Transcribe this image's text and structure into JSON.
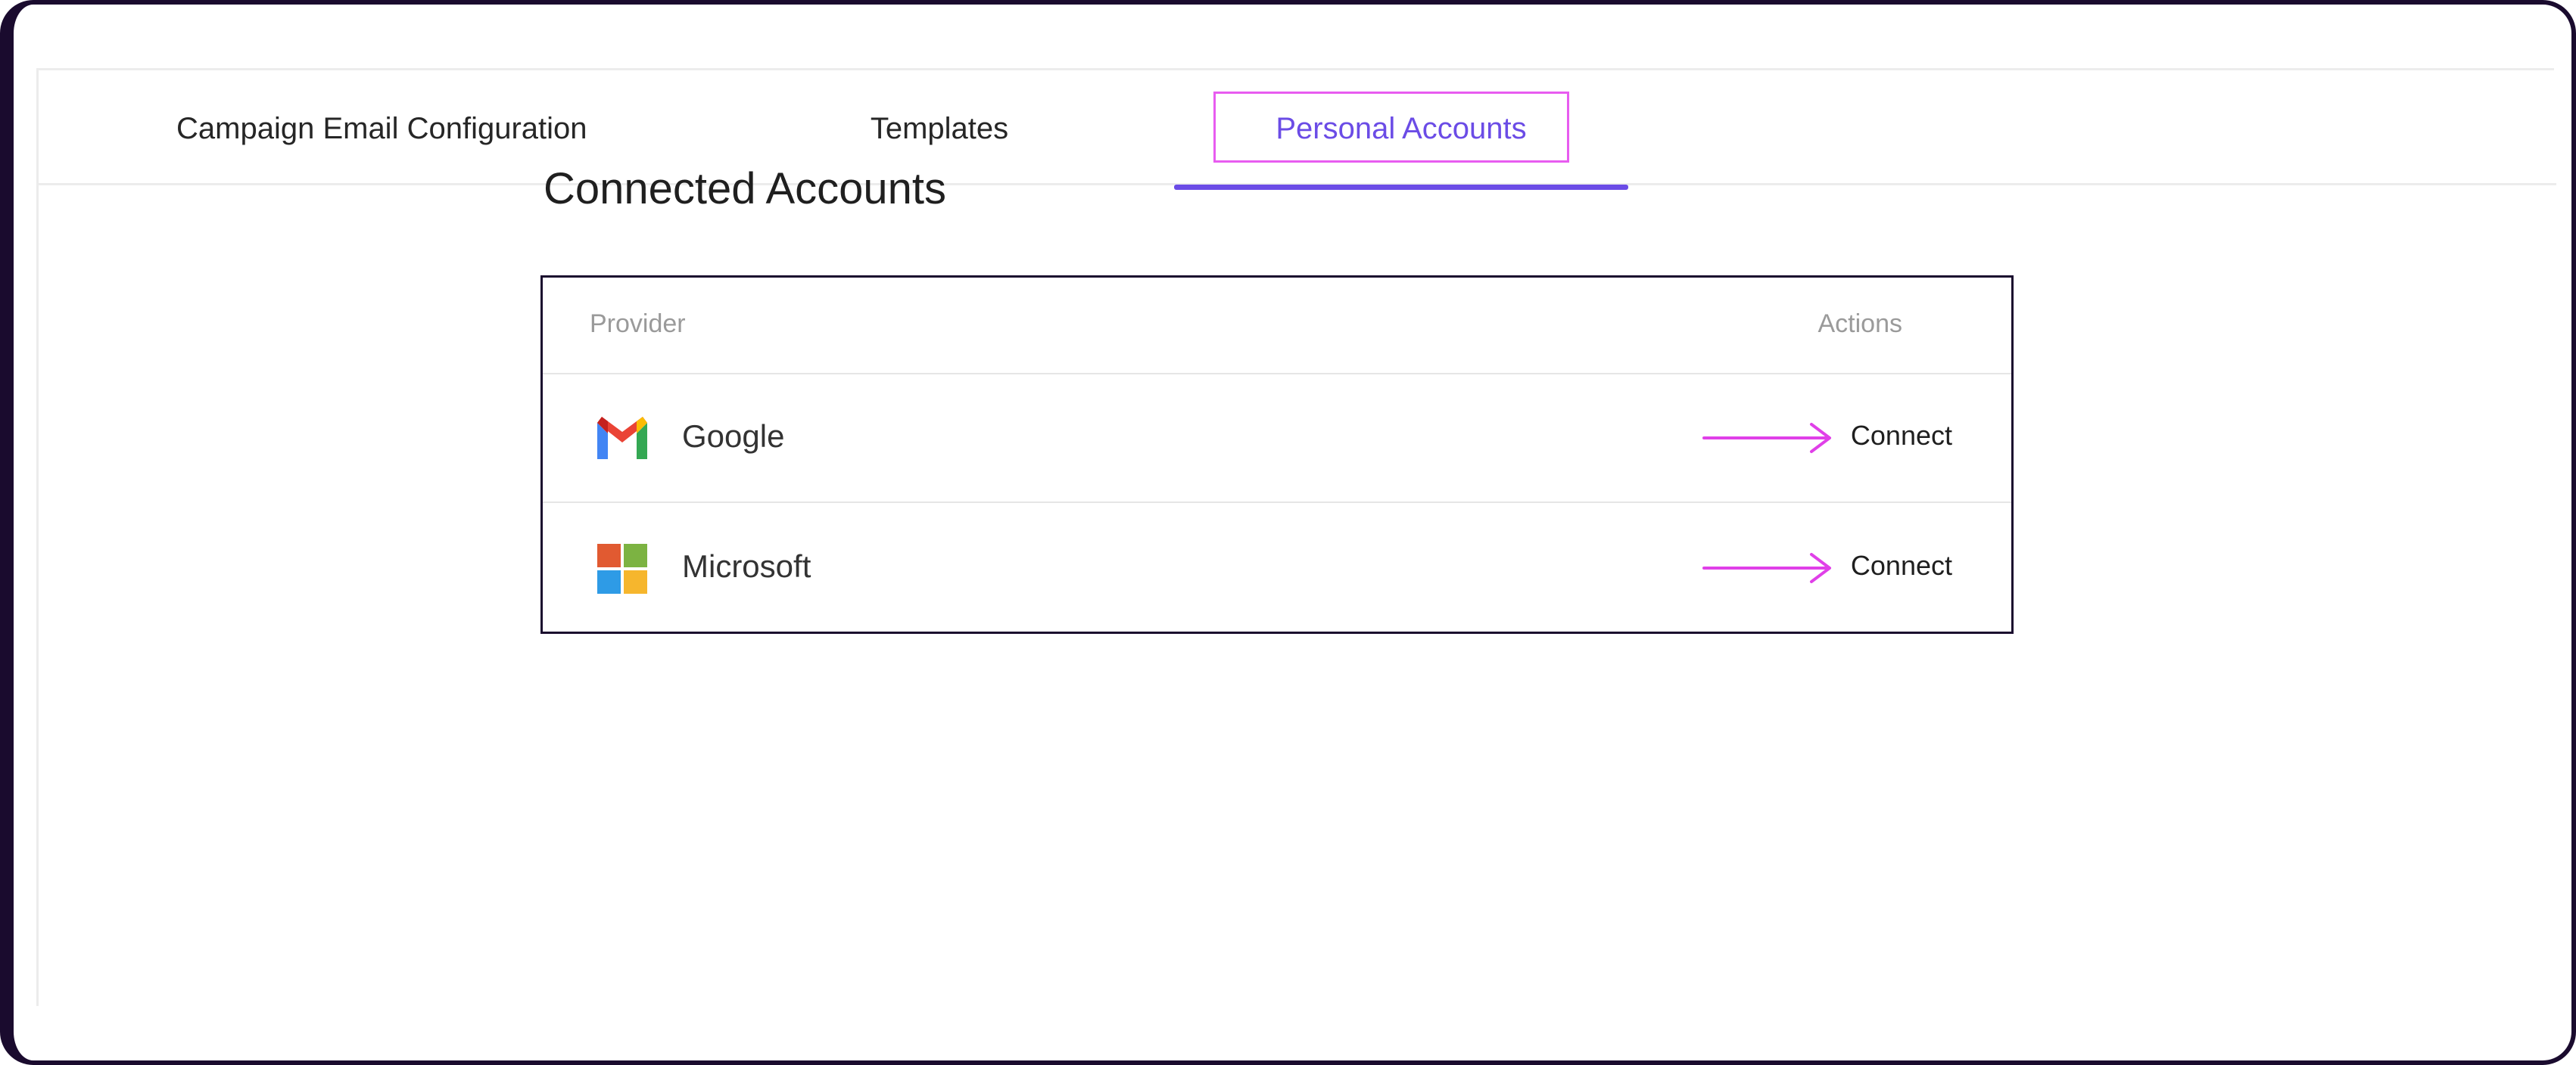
{
  "tabs": [
    {
      "label": "Campaign Email Configuration"
    },
    {
      "label": "Templates"
    },
    {
      "label": "Personal Accounts",
      "active": true
    }
  ],
  "colors": {
    "accent": "#6b4ce6",
    "highlight": "#e85cf0",
    "frame": "#1a0b2e"
  },
  "section": {
    "title": "Connected Accounts"
  },
  "table": {
    "headers": {
      "provider": "Provider",
      "actions": "Actions"
    },
    "rows": [
      {
        "provider": "Google",
        "icon": "gmail-icon",
        "action": "Connect"
      },
      {
        "provider": "Microsoft",
        "icon": "microsoft-icon",
        "action": "Connect"
      }
    ]
  }
}
